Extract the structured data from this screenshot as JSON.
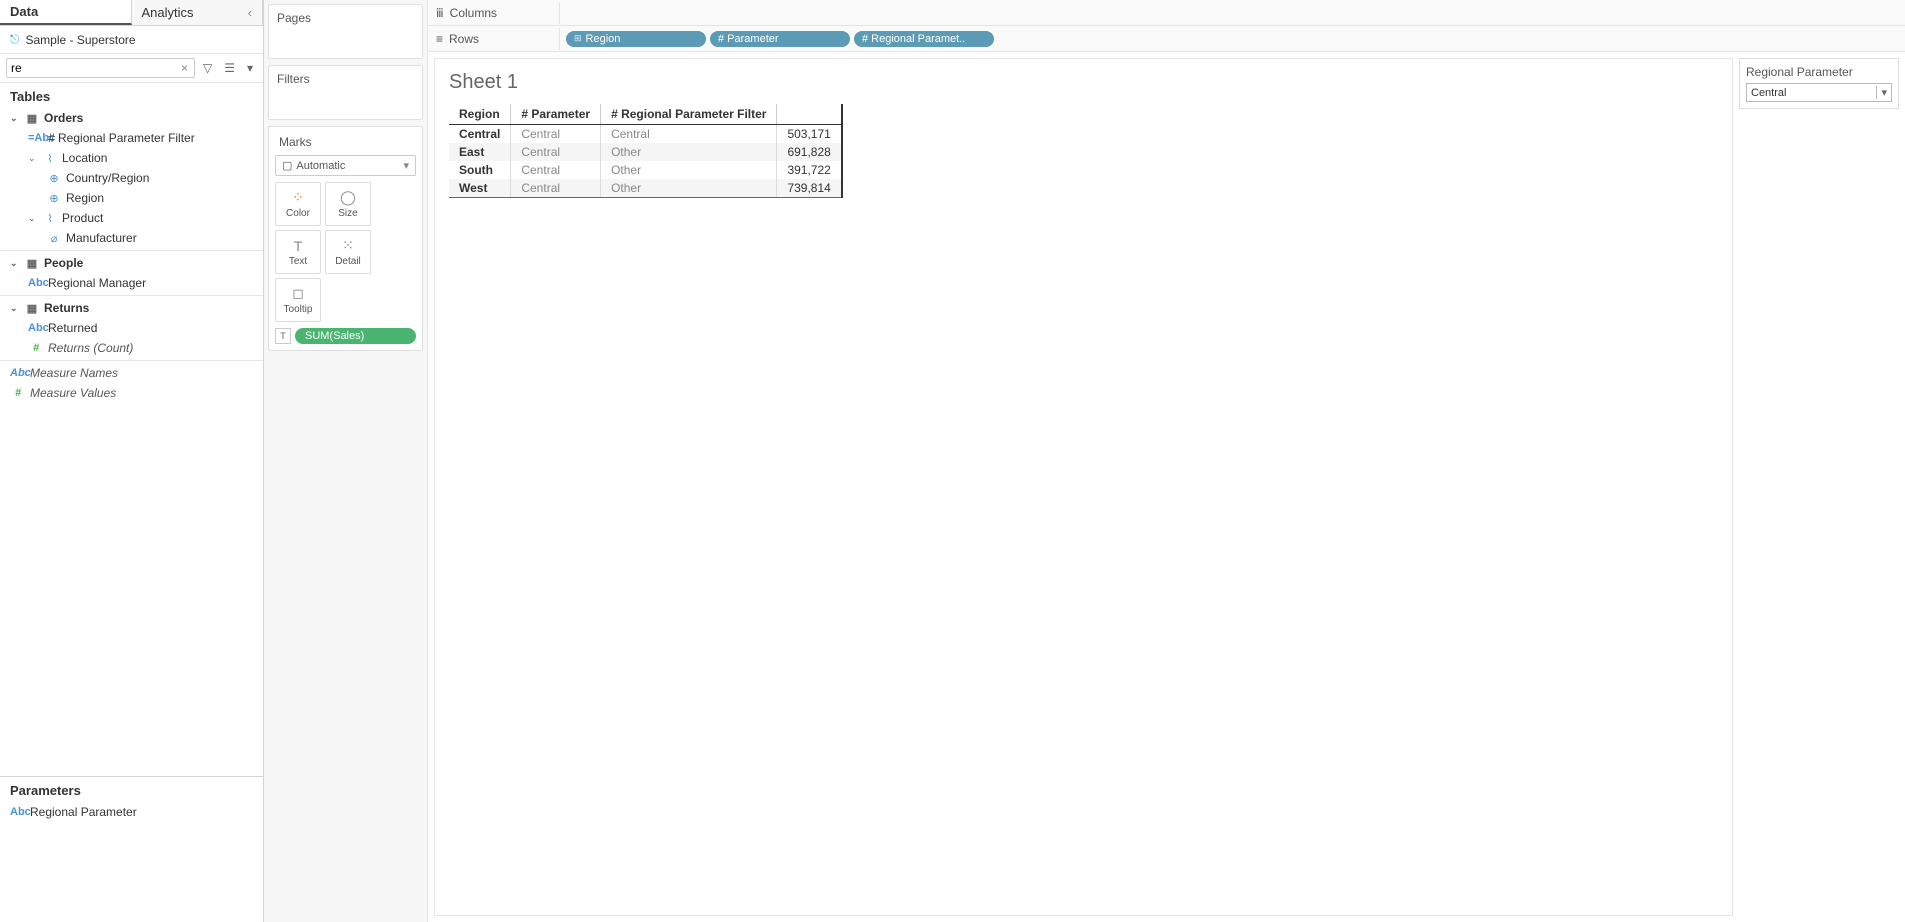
{
  "tabs": {
    "data": "Data",
    "analytics": "Analytics"
  },
  "datasource": {
    "name": "Sample - Superstore"
  },
  "search": {
    "value": "re"
  },
  "tables_header": "Tables",
  "tree": {
    "orders": "Orders",
    "regional_param_filter": "# Regional Parameter Filter",
    "location": "Location",
    "country_region": "Country/Region",
    "region": "Region",
    "product": "Product",
    "manufacturer": "Manufacturer",
    "people": "People",
    "regional_manager": "Regional Manager",
    "returns": "Returns",
    "returned": "Returned",
    "returns_count": "Returns (Count)",
    "measure_names": "Measure Names",
    "measure_values": "Measure Values"
  },
  "parameters_header": "Parameters",
  "parameters": {
    "regional_parameter": "Regional Parameter"
  },
  "shelves": {
    "pages": "Pages",
    "filters": "Filters",
    "marks": "Marks",
    "columns": "Columns",
    "rows": "Rows"
  },
  "marks": {
    "dropdown": "Automatic",
    "color": "Color",
    "size": "Size",
    "text": "Text",
    "detail": "Detail",
    "tooltip": "Tooltip",
    "pill": "SUM(Sales)"
  },
  "row_pills": {
    "region": "Region",
    "parameter": "# Parameter",
    "regional": "# Regional Paramet.."
  },
  "sheet": {
    "title": "Sheet 1",
    "headers": {
      "region": "Region",
      "parameter": "# Parameter",
      "filter": "# Regional Parameter Filter"
    },
    "rows": [
      {
        "region": "Central",
        "parameter": "Central",
        "filter": "Central",
        "value": "503,171"
      },
      {
        "region": "East",
        "parameter": "Central",
        "filter": "Other",
        "value": "691,828"
      },
      {
        "region": "South",
        "parameter": "Central",
        "filter": "Other",
        "value": "391,722"
      },
      {
        "region": "West",
        "parameter": "Central",
        "filter": "Other",
        "value": "739,814"
      }
    ]
  },
  "right_panel": {
    "title": "Regional Parameter",
    "value": "Central"
  }
}
